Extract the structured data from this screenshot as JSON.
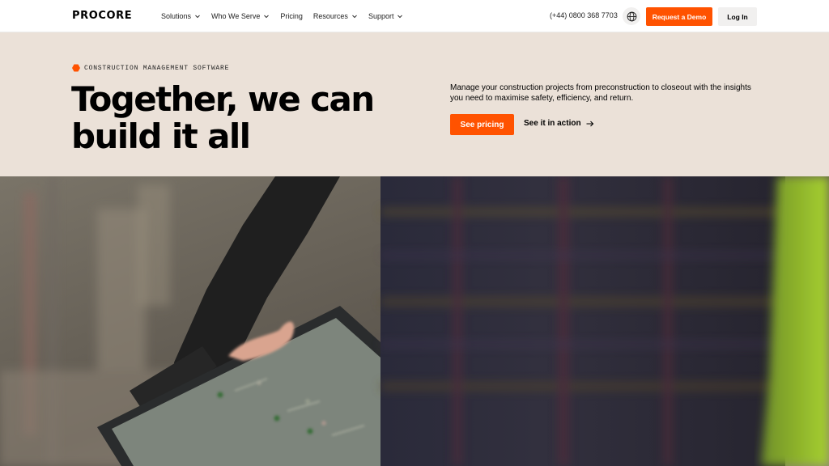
{
  "header": {
    "logo": "PROCORE",
    "nav": [
      {
        "label": "Solutions",
        "has_dropdown": true
      },
      {
        "label": "Who We Serve",
        "has_dropdown": true
      },
      {
        "label": "Pricing",
        "has_dropdown": false
      },
      {
        "label": "Resources",
        "has_dropdown": true
      },
      {
        "label": "Support",
        "has_dropdown": true
      }
    ],
    "phone": "(+44) 0800 368 7703",
    "globe_icon": "globe-icon",
    "demo_label": "Request a Demo",
    "login_label": "Log In"
  },
  "hero": {
    "eyebrow": "CONSTRUCTION MANAGEMENT SOFTWARE",
    "headline_line1": "Together, we can",
    "headline_line2": "build it all",
    "description": "Manage your construction projects from preconstruction to closeout with the insights you need to maximise safety, efficiency, and return.",
    "cta_primary": "See pricing",
    "cta_secondary": "See it in action",
    "cta_secondary_icon": "arrow-right-icon"
  },
  "colors": {
    "accent": "#ff5200",
    "hero_bg": "#ebe1d8",
    "button_light": "#f1f0ef"
  }
}
